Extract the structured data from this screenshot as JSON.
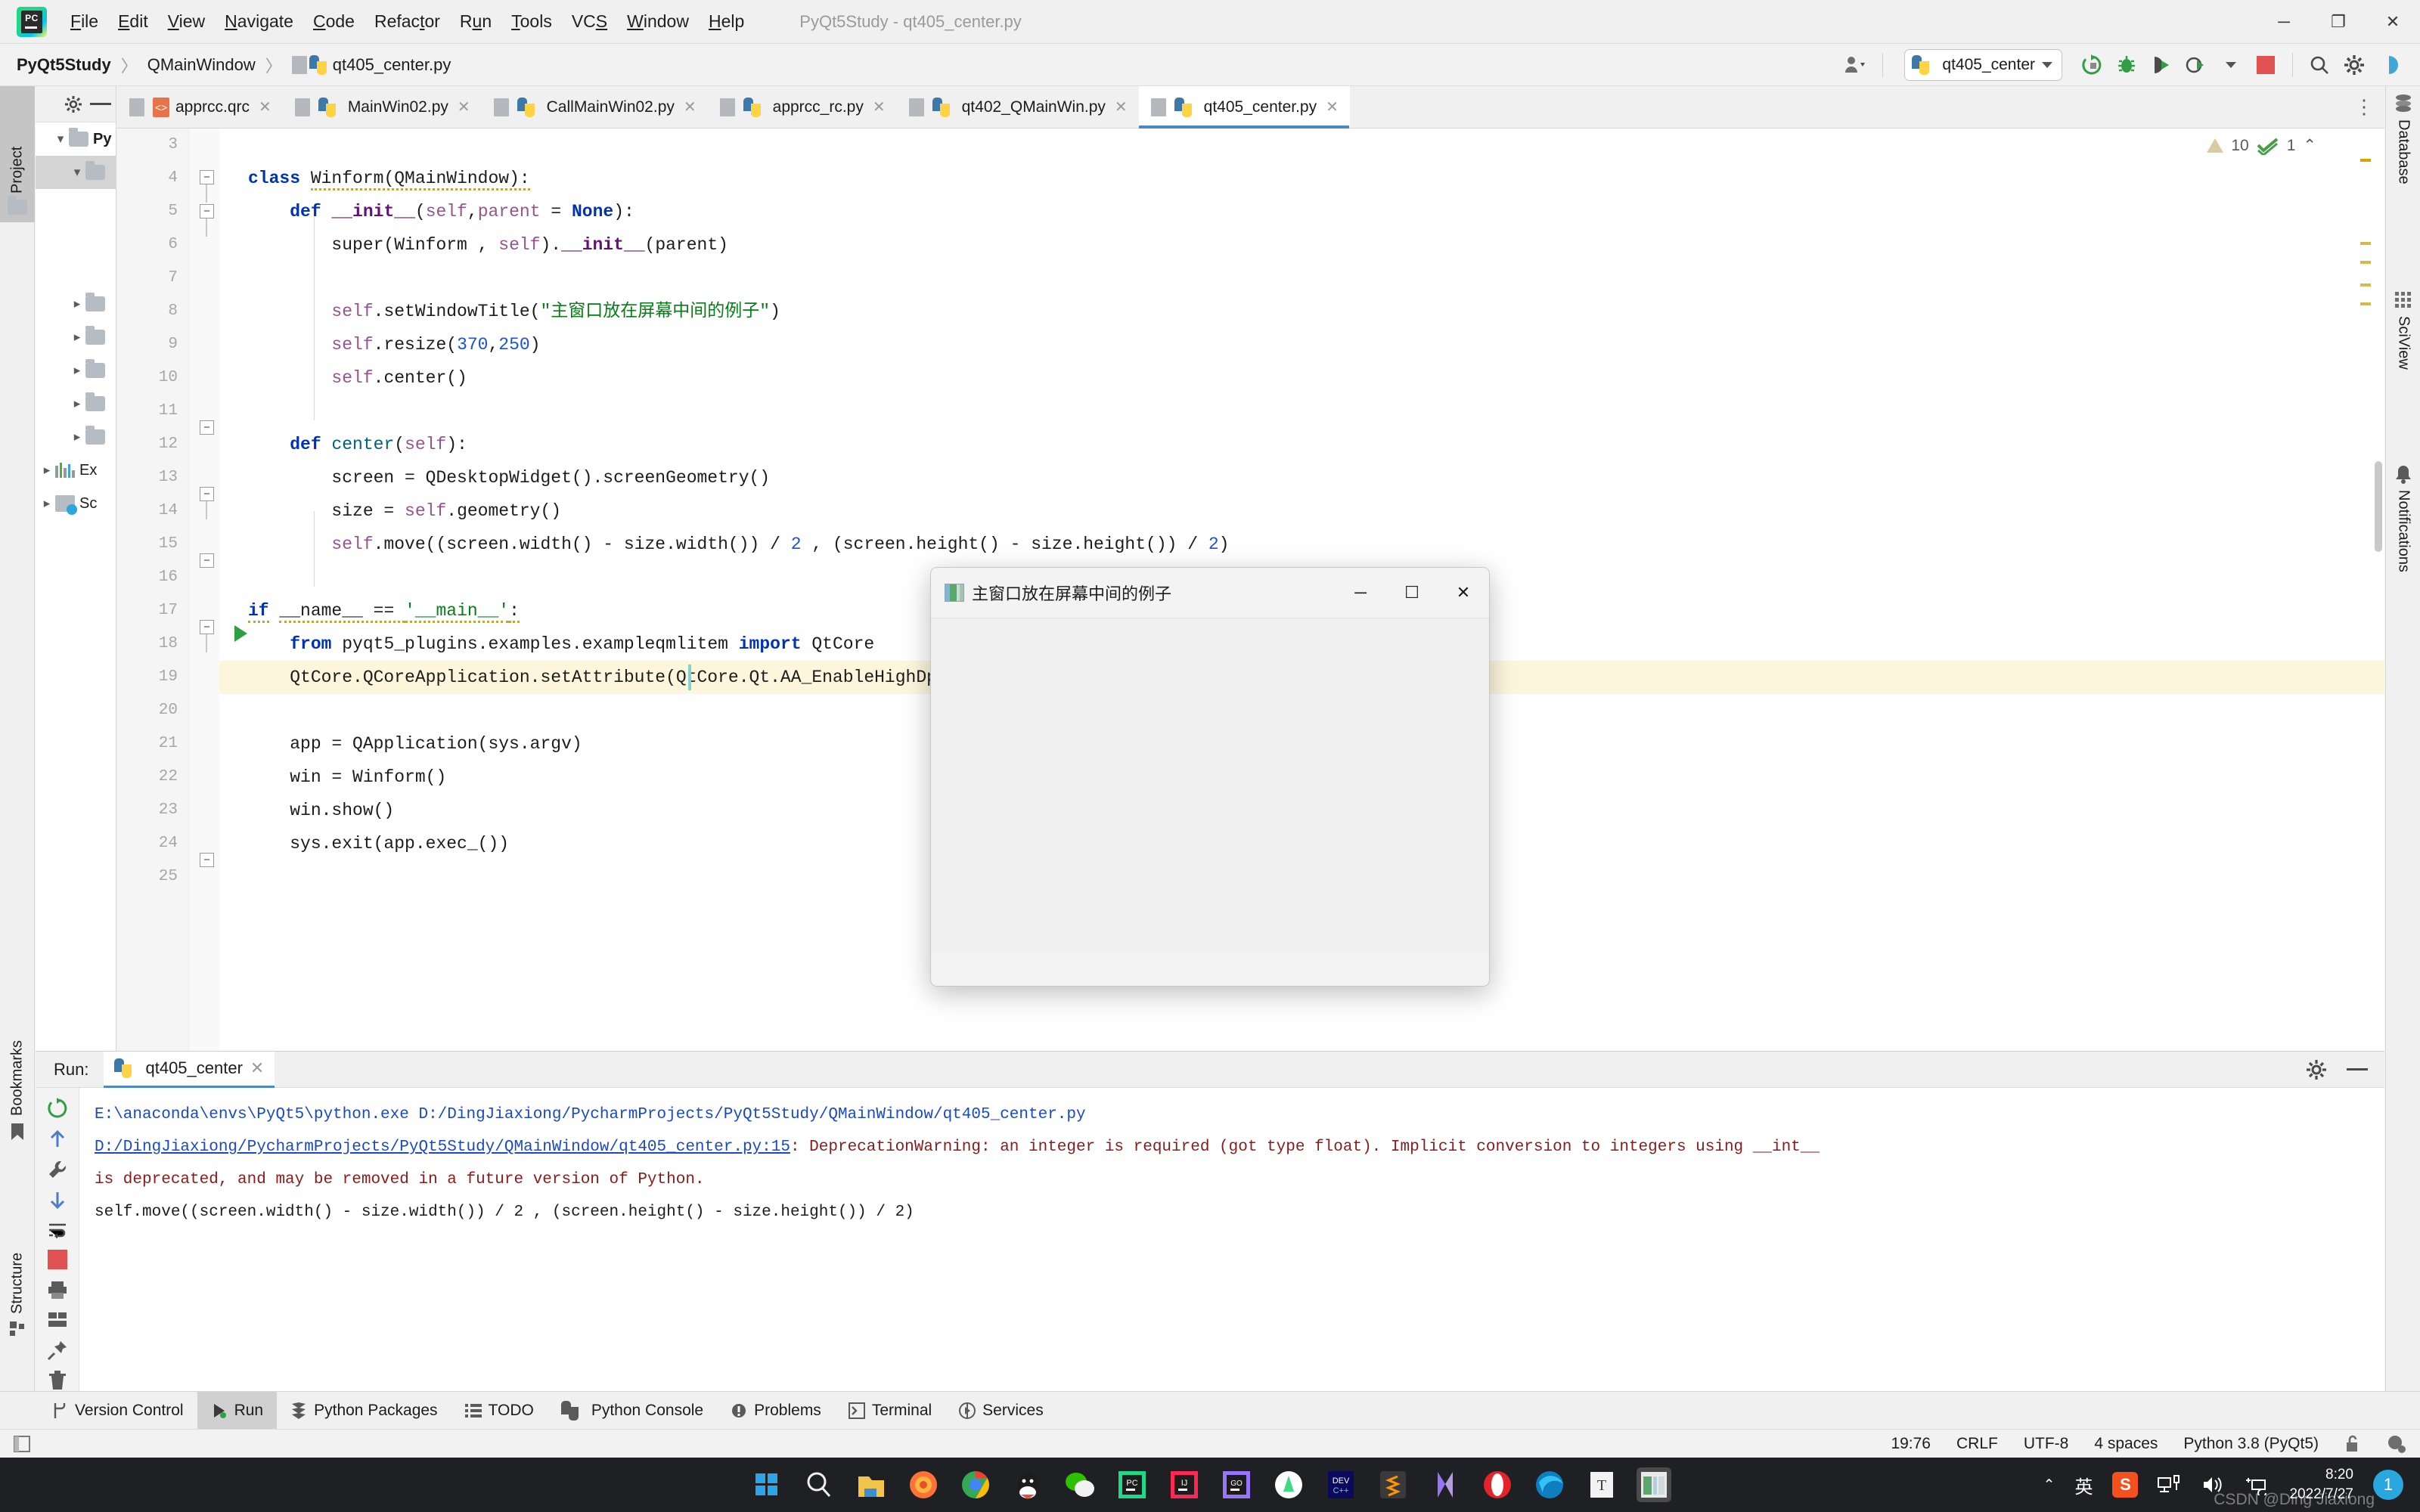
{
  "window": {
    "title": "PyQt5Study - qt405_center.py",
    "menu": [
      "File",
      "Edit",
      "View",
      "Navigate",
      "Code",
      "Refactor",
      "Run",
      "Tools",
      "VCS",
      "Window",
      "Help"
    ],
    "controls": {
      "minimize": "─",
      "maximize": "❐",
      "close": "✕"
    }
  },
  "breadcrumb": {
    "project": "PyQt5Study",
    "folder": "QMainWindow",
    "file": "qt405_center.py",
    "separator": "〉"
  },
  "toolbar": {
    "run_config": "qt405_center",
    "icons": [
      "user-dropdown-icon",
      "run-icon",
      "debug-icon",
      "run-coverage-icon",
      "profile-icon",
      "stop-icon",
      "search-icon",
      "settings-icon",
      "help-icon"
    ]
  },
  "left_strip": {
    "tabs": [
      "Project",
      "Bookmarks",
      "Structure"
    ]
  },
  "right_strip": {
    "tabs": [
      "Database",
      "SciView",
      "Notifications"
    ]
  },
  "project_tree": [
    {
      "label": "Py",
      "expanded": true,
      "type": "folder",
      "selected": false
    },
    {
      "label": "",
      "expanded": true,
      "type": "folder",
      "selected": true
    },
    {
      "label": "",
      "expanded": false,
      "type": "folder",
      "selected": false
    },
    {
      "label": "",
      "expanded": false,
      "type": "folder",
      "selected": false
    },
    {
      "label": "",
      "expanded": false,
      "type": "folder",
      "selected": false
    },
    {
      "label": "",
      "expanded": false,
      "type": "folder",
      "selected": false
    },
    {
      "label": "",
      "expanded": false,
      "type": "folder",
      "selected": false
    },
    {
      "label": "Ex",
      "expanded": false,
      "type": "library",
      "selected": false
    },
    {
      "label": "Sc",
      "expanded": false,
      "type": "scratch",
      "selected": false
    }
  ],
  "editor_tabs": [
    {
      "label": "apprcc.qrc",
      "icon": "qrc-file-icon",
      "active": false
    },
    {
      "label": "MainWin02.py",
      "icon": "python-file-icon",
      "active": false
    },
    {
      "label": "CallMainWin02.py",
      "icon": "python-file-icon",
      "active": false
    },
    {
      "label": "apprcc_rc.py",
      "icon": "python-file-icon",
      "active": false
    },
    {
      "label": "qt402_QMainWin.py",
      "icon": "python-file-icon",
      "active": false
    },
    {
      "label": "qt405_center.py",
      "icon": "python-file-icon",
      "active": true
    }
  ],
  "editor": {
    "inspection": {
      "warnings": "10",
      "checks": "1",
      "collapse": "⌃"
    },
    "breadcrumb_bottom": "if __name__ == '__main__'",
    "first_line_number": 3,
    "lines": [
      {
        "n": 3,
        "text": ""
      },
      {
        "n": 4,
        "text": "class Winform(QMainWindow):"
      },
      {
        "n": 5,
        "text": "    def __init__(self,parent = None):"
      },
      {
        "n": 6,
        "text": "        super(Winform , self).__init__(parent)"
      },
      {
        "n": 7,
        "text": ""
      },
      {
        "n": 8,
        "text": "        self.setWindowTitle(\"主窗口放在屏幕中间的例子\")"
      },
      {
        "n": 9,
        "text": "        self.resize(370,250)"
      },
      {
        "n": 10,
        "text": "        self.center()"
      },
      {
        "n": 11,
        "text": ""
      },
      {
        "n": 12,
        "text": "    def center(self):"
      },
      {
        "n": 13,
        "text": "        screen = QDesktopWidget().screenGeometry()"
      },
      {
        "n": 14,
        "text": "        size = self.geometry()"
      },
      {
        "n": 15,
        "text": "        self.move((screen.width() - size.width()) / 2 , (screen.height() - size.height()) / 2)"
      },
      {
        "n": 16,
        "text": ""
      },
      {
        "n": 17,
        "text": "if __name__ == '__main__':"
      },
      {
        "n": 18,
        "text": "    from pyqt5_plugins.examples.exampleqmlitem import QtCore"
      },
      {
        "n": 19,
        "text": "    QtCore.QCoreApplication.setAttribute(QtCore.Qt.AA_EnableHighDpiScaling)"
      },
      {
        "n": 20,
        "text": ""
      },
      {
        "n": 21,
        "text": "    app = QApplication(sys.argv)"
      },
      {
        "n": 22,
        "text": "    win = Winform()"
      },
      {
        "n": 23,
        "text": "    win.show()"
      },
      {
        "n": 24,
        "text": "    sys.exit(app.exec_())"
      },
      {
        "n": 25,
        "text": ""
      }
    ],
    "highlighted_line": 19
  },
  "qt_window": {
    "title": "主窗口放在屏幕中间的例子",
    "minimize": "─",
    "maximize": "☐",
    "close": "✕"
  },
  "run_panel": {
    "label": "Run:",
    "tab": "qt405_center",
    "close": "✕",
    "side_buttons": [
      "rerun-icon",
      "scroll-up-icon",
      "scroll-down-icon",
      "wrench-icon",
      "soft-wrap-icon",
      "stop-icon",
      "print-icon",
      "pin-icon",
      "trash-icon"
    ],
    "header_buttons": [
      "settings-icon",
      "minimize-icon"
    ],
    "console": [
      {
        "segments": [
          {
            "t": "E:\\anaconda\\envs\\PyQt5\\python.exe D:/DingJiaxiong/PycharmProjects/PyQt5Study/QMainWindow/qt405_center.py",
            "c": "c-blue"
          }
        ]
      },
      {
        "segments": [
          {
            "t": "D:/DingJiaxiong/PycharmProjects/PyQt5Study/QMainWindow/qt405_center.py:15",
            "c": "c-link"
          },
          {
            "t": ": DeprecationWarning: an integer is required (got type float).  Implicit conversion to integers using __int__",
            "c": "c-red"
          }
        ]
      },
      {
        "segments": [
          {
            "t": "  is deprecated, and may be removed in a future version of Python.",
            "c": "c-red"
          }
        ]
      },
      {
        "segments": [
          {
            "t": "  self.move((screen.width() - size.width()) / 2 , (screen.height() - size.height()) / 2)",
            "c": "c-black"
          }
        ]
      }
    ]
  },
  "bottom_tabs": [
    {
      "label": "Version Control",
      "icon": "branch-icon",
      "active": false
    },
    {
      "label": "Run",
      "icon": "run-icon",
      "active": true
    },
    {
      "label": "Python Packages",
      "icon": "packages-icon",
      "active": false
    },
    {
      "label": "TODO",
      "icon": "todo-icon",
      "active": false
    },
    {
      "label": "Python Console",
      "icon": "python-console-icon",
      "active": false
    },
    {
      "label": "Problems",
      "icon": "problems-icon",
      "active": false
    },
    {
      "label": "Terminal",
      "icon": "terminal-icon",
      "active": false
    },
    {
      "label": "Services",
      "icon": "services-icon",
      "active": false
    }
  ],
  "status_bar": {
    "caret": "19:76",
    "line_ending": "CRLF",
    "encoding": "UTF-8",
    "indent": "4 spaces",
    "interpreter": "Python 3.8 (PyQt5)",
    "icons": [
      "lock-open-icon",
      "event-log-icon"
    ]
  },
  "taskbar": {
    "icons": [
      "start-icon",
      "search-icon",
      "file-explorer-icon",
      "firefox-icon",
      "chrome-icon",
      "qq-icon",
      "wechat-icon",
      "pycharm-icon",
      "intellij-icon",
      "goland-icon",
      "android-studio-icon",
      "devcpp-icon",
      "sublime-icon",
      "nvidia-icon",
      "edge-icon",
      "edge2-icon",
      "typora-icon",
      "qt-app-icon"
    ],
    "tray": {
      "chevron": "⌃",
      "ime": "英",
      "sogou": "S",
      "network": "network-icon",
      "volume": "volume-icon",
      "battery": "battery-icon"
    },
    "time": "8:20",
    "date": "2022/7/27",
    "badge": "1",
    "watermark": "CSDN @Ding Jiaxiong"
  },
  "colors": {
    "accent": "#4a88c7",
    "keyword": "#0033b3",
    "string": "#067d17",
    "number": "#1750eb",
    "self": "#94558d",
    "error": "#8b1a1a",
    "link": "#1a49c7",
    "highlight_row": "#fdf6dd"
  }
}
